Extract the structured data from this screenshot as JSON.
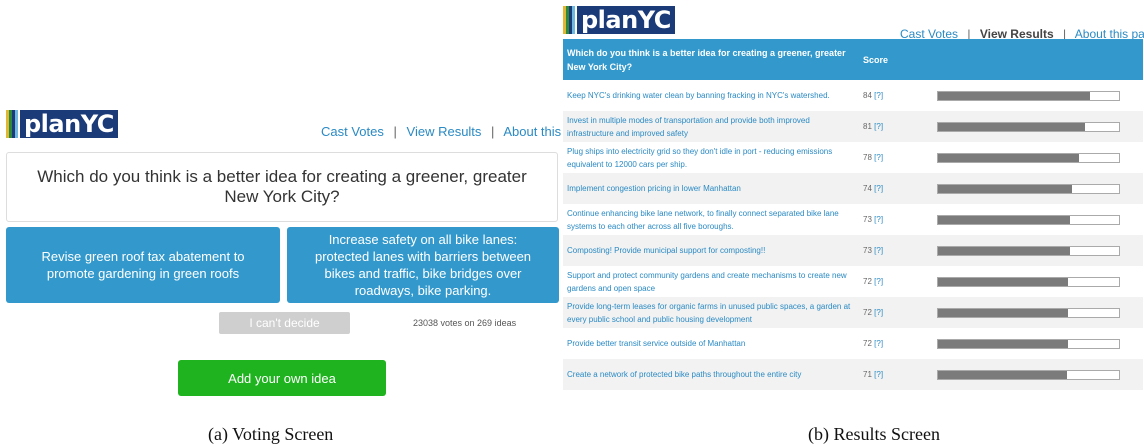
{
  "brand": {
    "logo_text": "planYC",
    "stripe_colors": [
      "#e0b632",
      "#2b8a3e",
      "#1b3a78",
      "#6fb8e0"
    ]
  },
  "nav": {
    "cast_votes": "Cast Votes",
    "view_results": "View Results",
    "about": "About this page",
    "separator": "|"
  },
  "voting": {
    "question": "Which do you think is a better idea for creating a greener, greater New York City?",
    "choice_left": "Revise green roof tax abatement to promote gardening in green roofs",
    "choice_right": "Increase safety on all bike lanes: protected lanes with barriers between bikes and traffic, bike bridges over roadways, bike parking.",
    "cant_decide": "I can't decide",
    "vote_count": "23038 votes on 269 ideas",
    "add_idea": "Add your own idea",
    "caption": "(a) Voting Screen"
  },
  "results": {
    "header_question": "Which do you think is a better idea for creating a greener, greater New York City?",
    "header_score": "Score",
    "help_label": "[?]",
    "caption": "(b) Results Screen",
    "rows": [
      {
        "idea": "Keep NYC's drinking water clean by banning fracking in NYC's watershed.",
        "score": "84",
        "value": 84
      },
      {
        "idea": "Invest in multiple modes of transportation and provide both improved infrastructure and improved safety",
        "score": "81",
        "value": 81
      },
      {
        "idea": "Plug ships into electricity grid so they don't idle in port - reducing emissions equivalent to 12000 cars per ship.",
        "score": "78",
        "value": 78
      },
      {
        "idea": "Implement congestion pricing in lower Manhattan",
        "score": "74",
        "value": 74
      },
      {
        "idea": "Continue enhancing bike lane network, to finally connect separated bike lane systems to each other across all five boroughs.",
        "score": "73",
        "value": 73
      },
      {
        "idea": "Composting! Provide municipal support for composting!!",
        "score": "73",
        "value": 73
      },
      {
        "idea": "Support and protect community gardens and create mechanisms to create new gardens and open space",
        "score": "72",
        "value": 72
      },
      {
        "idea": "Provide long-term leases for organic farms in unused public spaces, a garden at every public school and public housing development",
        "score": "72",
        "value": 72
      },
      {
        "idea": "Provide better transit service outside of Manhattan",
        "score": "72",
        "value": 72
      },
      {
        "idea": "Create a network of protected bike paths throughout the entire city",
        "score": "71",
        "value": 71
      }
    ]
  }
}
